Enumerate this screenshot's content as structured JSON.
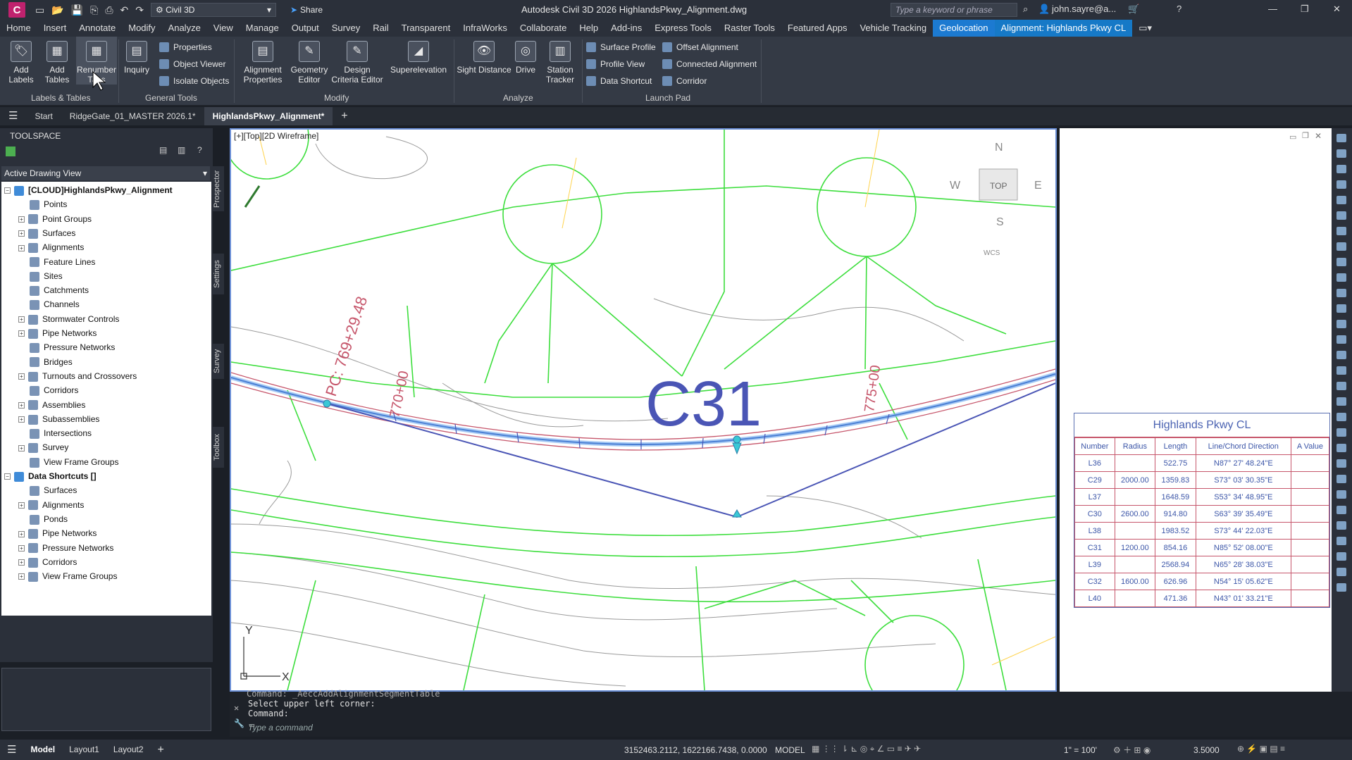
{
  "titlebar": {
    "app_letter": "C",
    "workspace": "Civil 3D",
    "share": "Share",
    "title": "Autodesk Civil 3D 2026   HighlandsPkwy_Alignment.dwg",
    "search_placeholder": "Type a keyword or phrase",
    "user": "john.sayre@a..."
  },
  "ribbon_tabs": [
    "Home",
    "Insert",
    "Annotate",
    "Modify",
    "Analyze",
    "View",
    "Manage",
    "Output",
    "Survey",
    "Rail",
    "Transparent",
    "InfraWorks",
    "Collaborate",
    "Help",
    "Add-ins",
    "Express Tools",
    "Raster Tools",
    "Featured Apps",
    "Vehicle Tracking",
    "Geolocation",
    "Alignment: Highlands Pkwy CL"
  ],
  "ribbon": {
    "add_labels": "Add Labels",
    "add_tables": "Add Tables",
    "renumber_tags": "Renumber Tags",
    "inquiry": "Inquiry",
    "properties": "Properties",
    "object_viewer": "Object Viewer",
    "isolate_objects": "Isolate Objects",
    "alignment_properties": "Alignment Properties",
    "geometry_editor": "Geometry Editor",
    "design_criteria_editor": "Design Criteria Editor",
    "superelevation": "Superelevation",
    "sight_distance": "Sight Distance",
    "drive": "Drive",
    "station_tracker": "Station Tracker",
    "surface_profile": "Surface Profile",
    "profile_view": "Profile View",
    "data_shortcut": "Data Shortcut",
    "offset_alignment": "Offset Alignment",
    "connected_alignment": "Connected Alignment",
    "corridor": "Corridor",
    "panel_labels_tables": "Labels & Tables",
    "panel_general_tools": "General Tools",
    "panel_modify": "Modify",
    "panel_analyze": "Analyze",
    "panel_launch_pad": "Launch Pad"
  },
  "file_tabs": [
    "Start",
    "RidgeGate_01_MASTER 2026.1*",
    "HighlandsPkwy_Alignment*"
  ],
  "toolspace": {
    "title": "TOOLSPACE",
    "view_select": "Active Drawing View",
    "root": "[CLOUD]HighlandsPkwy_Alignment",
    "items": [
      "Points",
      "Point Groups",
      "Surfaces",
      "Alignments",
      "Feature Lines",
      "Sites",
      "Catchments",
      "Channels",
      "Stormwater Controls",
      "Pipe Networks",
      "Pressure Networks",
      "Bridges",
      "Turnouts and Crossovers",
      "Corridors",
      "Assemblies",
      "Subassemblies",
      "Intersections",
      "Survey",
      "View Frame Groups"
    ],
    "shortcuts_root": "Data Shortcuts []",
    "shortcut_items": [
      "Surfaces",
      "Alignments",
      "Ponds",
      "Pipe Networks",
      "Pressure Networks",
      "Corridors",
      "View Frame Groups"
    ],
    "side_tabs": [
      "Prospector",
      "Settings",
      "Survey",
      "Toolbox"
    ]
  },
  "viewport": {
    "label": "[+][Top][2D Wireframe]",
    "curve_label": "C31",
    "station_pc": "PC: 769+29.48",
    "station_770": "770+00",
    "station_775": "775+00",
    "viewcube": {
      "n": "N",
      "s": "S",
      "e": "E",
      "w": "W",
      "top": "TOP",
      "wcs": "WCS"
    },
    "ucs_x": "X",
    "ucs_y": "Y"
  },
  "table": {
    "title": "Highlands Pkwy CL",
    "headers": [
      "Number",
      "Radius",
      "Length",
      "Line/Chord Direction",
      "A Value"
    ],
    "rows": [
      [
        "L36",
        "",
        "522.75",
        "N87° 27' 48.24\"E",
        ""
      ],
      [
        "C29",
        "2000.00",
        "1359.83",
        "S73° 03' 30.35\"E",
        ""
      ],
      [
        "L37",
        "",
        "1648.59",
        "S53° 34' 48.95\"E",
        ""
      ],
      [
        "C30",
        "2600.00",
        "914.80",
        "S63° 39' 35.49\"E",
        ""
      ],
      [
        "L38",
        "",
        "1983.52",
        "S73° 44' 22.03\"E",
        ""
      ],
      [
        "C31",
        "1200.00",
        "854.16",
        "N85° 52' 08.00\"E",
        ""
      ],
      [
        "L39",
        "",
        "2568.94",
        "N65° 28' 38.03\"E",
        ""
      ],
      [
        "C32",
        "1600.00",
        "626.96",
        "N54° 15' 05.62\"E",
        ""
      ],
      [
        "L40",
        "",
        "471.36",
        "N43° 01' 33.21\"E",
        ""
      ]
    ]
  },
  "command": {
    "line1": "Command: _AeccAddAlignmentSegmentTable",
    "line2": "Select upper left corner:",
    "line3": "Command:",
    "placeholder": "Type a command"
  },
  "status": {
    "layouts": [
      "Model",
      "Layout1",
      "Layout2"
    ],
    "coords": "3152463.2112, 1622166.7438, 0.0000",
    "mode": "MODEL",
    "scale": "1\" = 100'",
    "value": "3.5000"
  },
  "colors": {
    "accent": "#1c7ad1",
    "lot_lines": "#3dde3d",
    "alignment": "#4a7fd4",
    "road_edge": "#c6566b",
    "table_text": "#3c56a8"
  }
}
